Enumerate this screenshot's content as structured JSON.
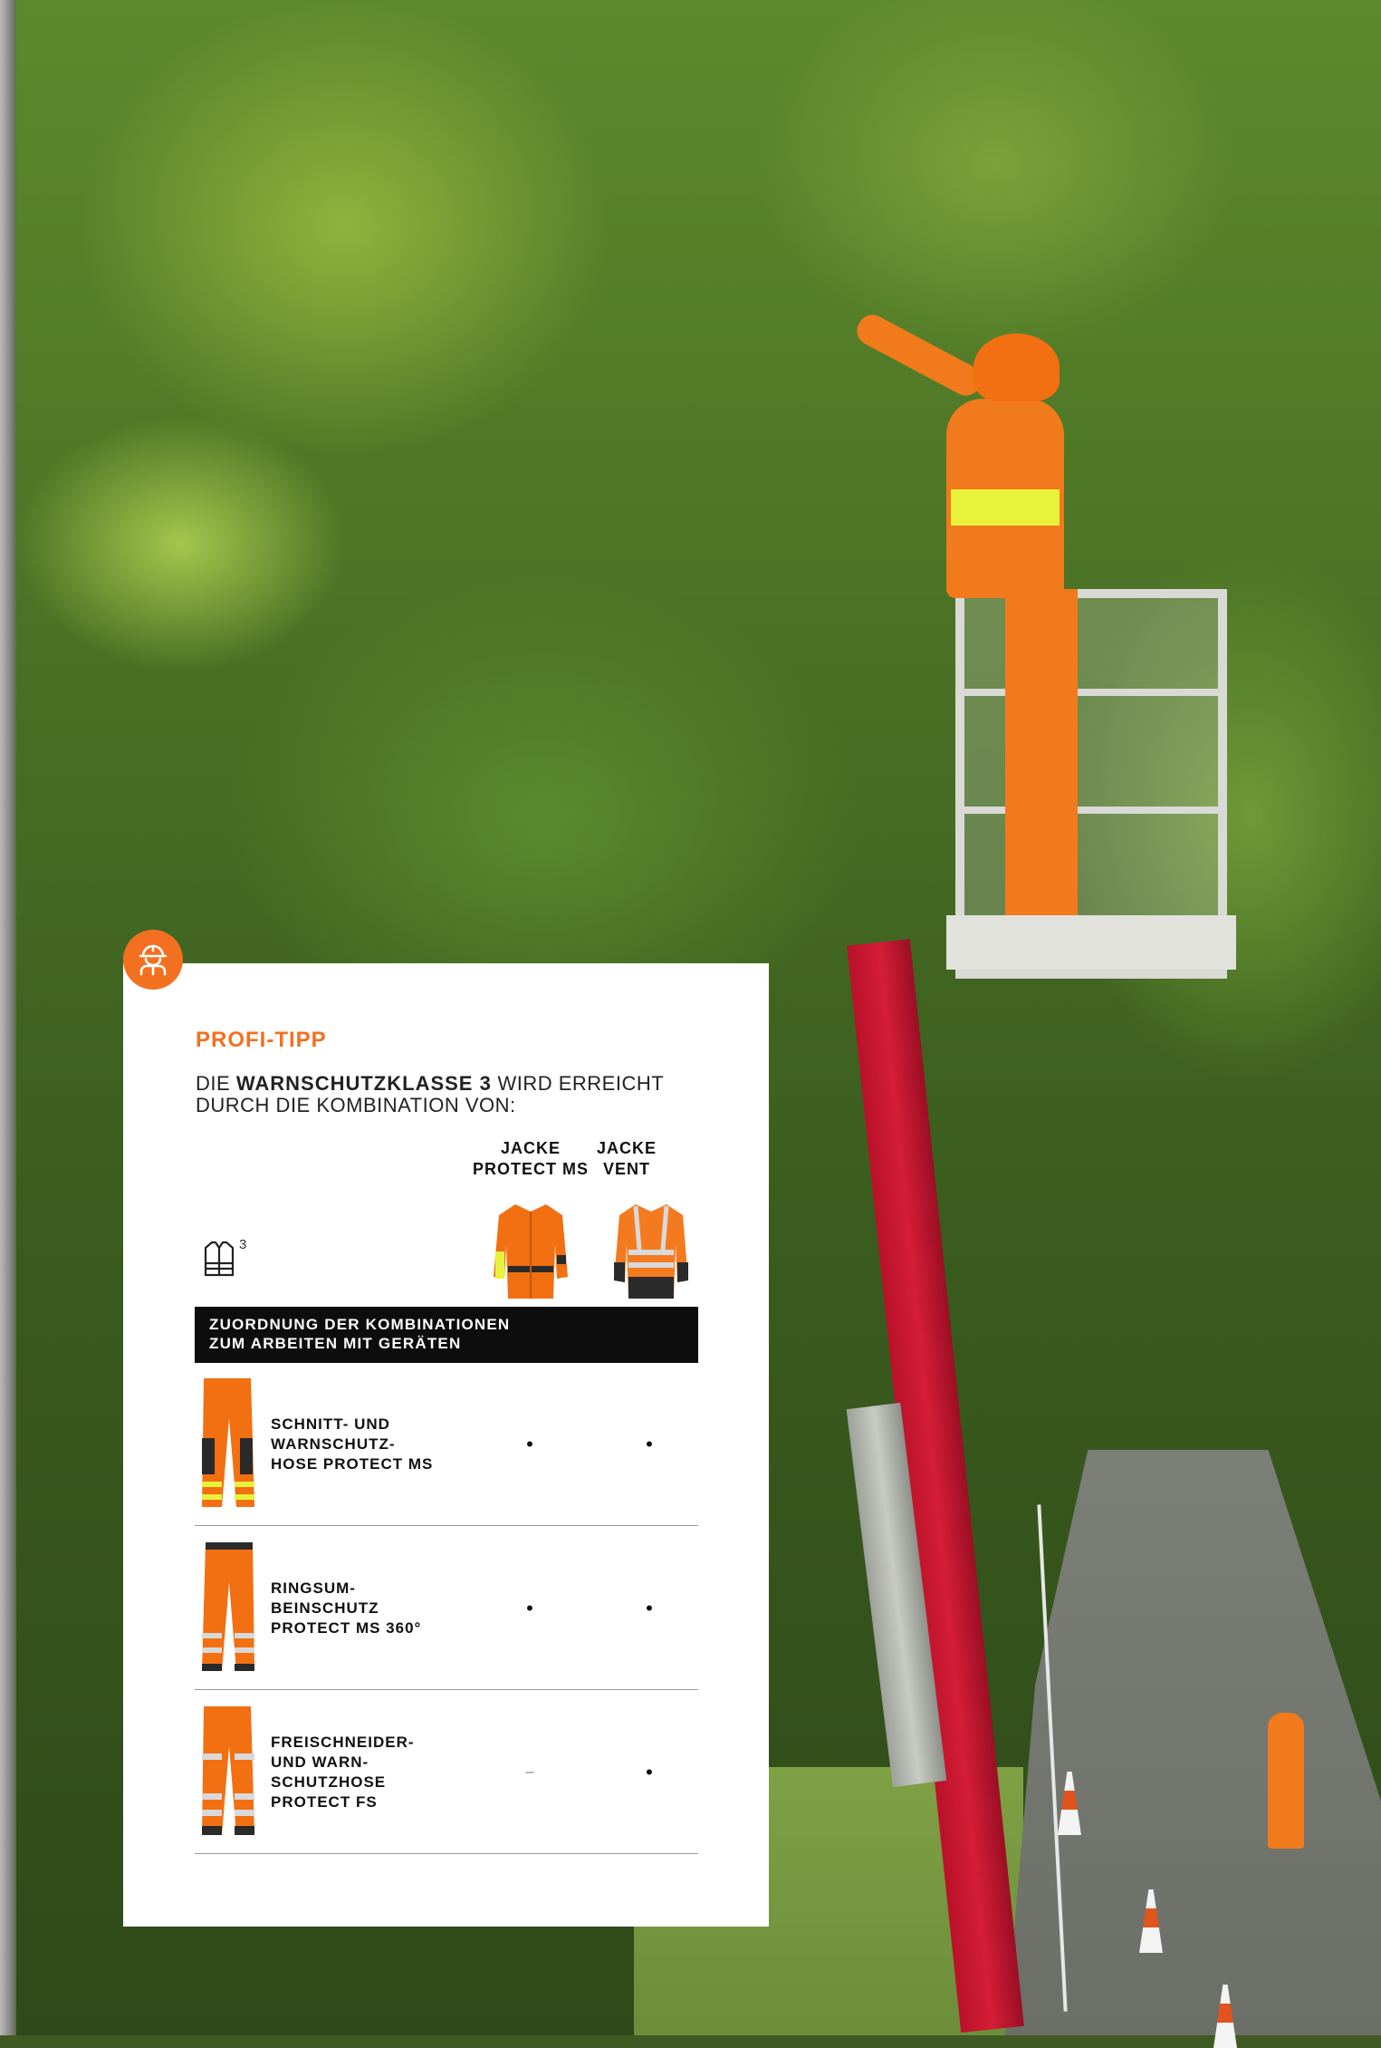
{
  "card": {
    "title": "PROFI-TIPP",
    "intro_prefix": "DIE",
    "intro_bold": "WARNSCHUTZKLASSE 3",
    "intro_suffix": "WIRD ERREICHT DURCH DIE KOMBINATION VON:",
    "columns": [
      {
        "label": "JACKE\nPROTECT MS"
      },
      {
        "label": "JACKE\nVENT"
      }
    ],
    "class_icon": "warning-vest-class-icon",
    "class_number": "3",
    "section_header": "ZUORDNUNG DER KOMBINATIONEN\nZUM ARBEITEN MIT GERÄTEN",
    "rows": [
      {
        "label": "SCHNITT- UND\nWARNSCHUTZ-\nHOSE PROTECT MS",
        "marks": [
          "•",
          "•"
        ]
      },
      {
        "label": "RINGSUM-\nBEINSCHUTZ\nPROTECT MS 360°",
        "marks": [
          "•",
          "•"
        ]
      },
      {
        "label": "FREISCHNEIDER-\nUND WARN-\nSCHUTZHOSE\nPROTECT FS",
        "marks": [
          "–",
          "•"
        ]
      }
    ]
  },
  "badge_icon": "worker-helmet-icon",
  "colors": {
    "accent": "#f37021",
    "header_bar": "#0d0d0d",
    "hi_vis_yellow": "#e8f23a"
  }
}
